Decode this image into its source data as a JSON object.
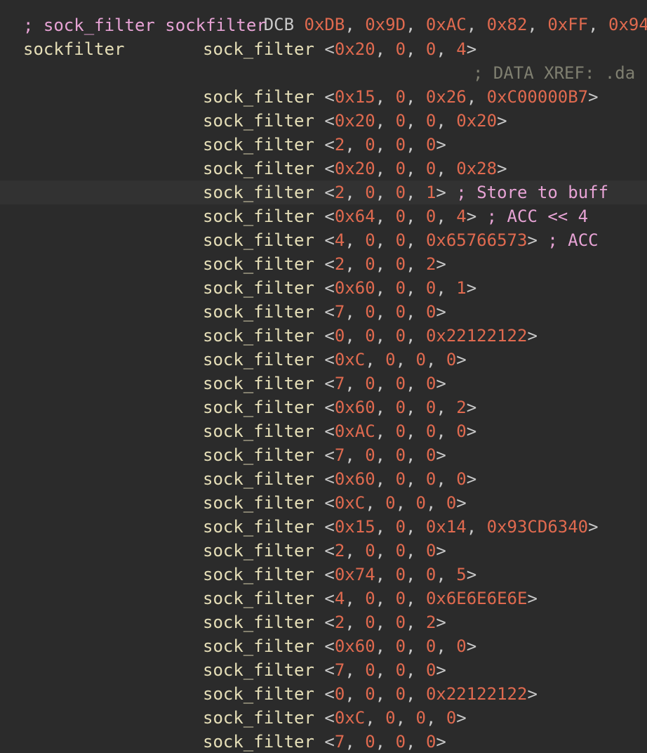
{
  "top_partial": {
    "mnemonic": "DCB",
    "values": [
      "0xDB",
      "0x9D",
      "0xAC",
      "0x82",
      "0xFF",
      "0x94"
    ]
  },
  "struct_comment": "; sock_filter sockfilter",
  "label": "sockfilter",
  "mnemonic": "sock_filter",
  "xref_comment": "; DATA XREF: .da",
  "highlighted_row": 5,
  "colors": {
    "background": "#2b2b2b",
    "highlight": "#323232",
    "mnemonic": "#e6dfb8",
    "number": "#e06a4f",
    "comment": "#e7a3d5",
    "xref": "#7f7f70"
  },
  "rows": [
    {
      "args": [
        "0x20",
        "0",
        "0",
        "4"
      ],
      "comment": ""
    },
    {
      "args": [
        "0x15",
        "0",
        "0x26",
        "0xC00000B7"
      ],
      "comment": ""
    },
    {
      "args": [
        "0x20",
        "0",
        "0",
        "0x20"
      ],
      "comment": ""
    },
    {
      "args": [
        "2",
        "0",
        "0",
        "0"
      ],
      "comment": ""
    },
    {
      "args": [
        "0x20",
        "0",
        "0",
        "0x28"
      ],
      "comment": ""
    },
    {
      "args": [
        "2",
        "0",
        "0",
        "1"
      ],
      "comment": "; Store to buff"
    },
    {
      "args": [
        "0x64",
        "0",
        "0",
        "4"
      ],
      "comment": "; ACC << 4"
    },
    {
      "args": [
        "4",
        "0",
        "0",
        "0x65766573"
      ],
      "comment": "; ACC"
    },
    {
      "args": [
        "2",
        "0",
        "0",
        "2"
      ],
      "comment": ""
    },
    {
      "args": [
        "0x60",
        "0",
        "0",
        "1"
      ],
      "comment": ""
    },
    {
      "args": [
        "7",
        "0",
        "0",
        "0"
      ],
      "comment": ""
    },
    {
      "args": [
        "0",
        "0",
        "0",
        "0x22122122"
      ],
      "comment": ""
    },
    {
      "args": [
        "0xC",
        "0",
        "0",
        "0"
      ],
      "comment": ""
    },
    {
      "args": [
        "7",
        "0",
        "0",
        "0"
      ],
      "comment": ""
    },
    {
      "args": [
        "0x60",
        "0",
        "0",
        "2"
      ],
      "comment": ""
    },
    {
      "args": [
        "0xAC",
        "0",
        "0",
        "0"
      ],
      "comment": ""
    },
    {
      "args": [
        "7",
        "0",
        "0",
        "0"
      ],
      "comment": ""
    },
    {
      "args": [
        "0x60",
        "0",
        "0",
        "0"
      ],
      "comment": ""
    },
    {
      "args": [
        "0xC",
        "0",
        "0",
        "0"
      ],
      "comment": ""
    },
    {
      "args": [
        "0x15",
        "0",
        "0x14",
        "0x93CD6340"
      ],
      "comment": ""
    },
    {
      "args": [
        "2",
        "0",
        "0",
        "0"
      ],
      "comment": ""
    },
    {
      "args": [
        "0x74",
        "0",
        "0",
        "5"
      ],
      "comment": ""
    },
    {
      "args": [
        "4",
        "0",
        "0",
        "0x6E6E6E6E"
      ],
      "comment": ""
    },
    {
      "args": [
        "2",
        "0",
        "0",
        "2"
      ],
      "comment": ""
    },
    {
      "args": [
        "0x60",
        "0",
        "0",
        "0"
      ],
      "comment": ""
    },
    {
      "args": [
        "7",
        "0",
        "0",
        "0"
      ],
      "comment": ""
    },
    {
      "args": [
        "0",
        "0",
        "0",
        "0x22122122"
      ],
      "comment": ""
    },
    {
      "args": [
        "0xC",
        "0",
        "0",
        "0"
      ],
      "comment": ""
    },
    {
      "args": [
        "7",
        "0",
        "0",
        "0"
      ],
      "comment": ""
    }
  ]
}
